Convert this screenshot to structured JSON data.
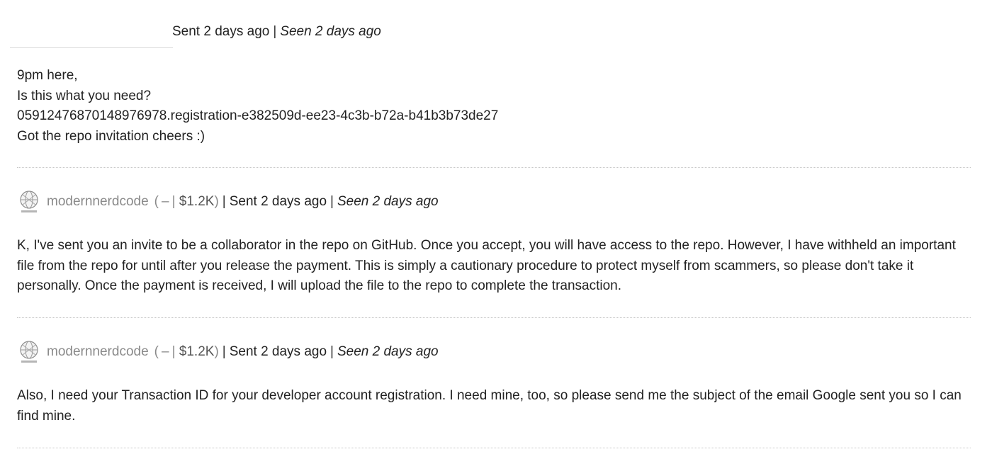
{
  "messages": [
    {
      "sent": "Sent 2 days ago",
      "seen": "Seen 2 days ago",
      "lines": [
        "9pm here,",
        "Is this what you need?",
        "0591247687014897697​8.registration-e382509d-ee23-4c3b-b72a-b41b3b73de27",
        "Got the repo invitation cheers :)"
      ]
    },
    {
      "username": "modernnerdcode",
      "rep_dash": "–",
      "rep_amount": "$1.2K",
      "sent": "Sent 2 days ago",
      "seen": "Seen 2 days ago",
      "text": "K, I've sent you an invite to be a collaborator in the repo on GitHub. Once you accept, you will have access to the repo. However, I have withheld an important file from the repo for until after you release the payment. This is simply a cautionary procedure to protect myself from scammers, so please don't take it personally. Once the payment is received, I will upload the file to the repo to complete the transaction."
    },
    {
      "username": "modernnerdcode",
      "rep_dash": "–",
      "rep_amount": "$1.2K",
      "sent": "Sent 2 days ago",
      "seen": "Seen 2 days ago",
      "text": "Also, I need your Transaction ID for your developer account registration. I need mine, too, so please send me the subject of the email Google sent you so I can find mine."
    }
  ],
  "separator": "|",
  "avatar_icon": "avatar-globe-icon"
}
